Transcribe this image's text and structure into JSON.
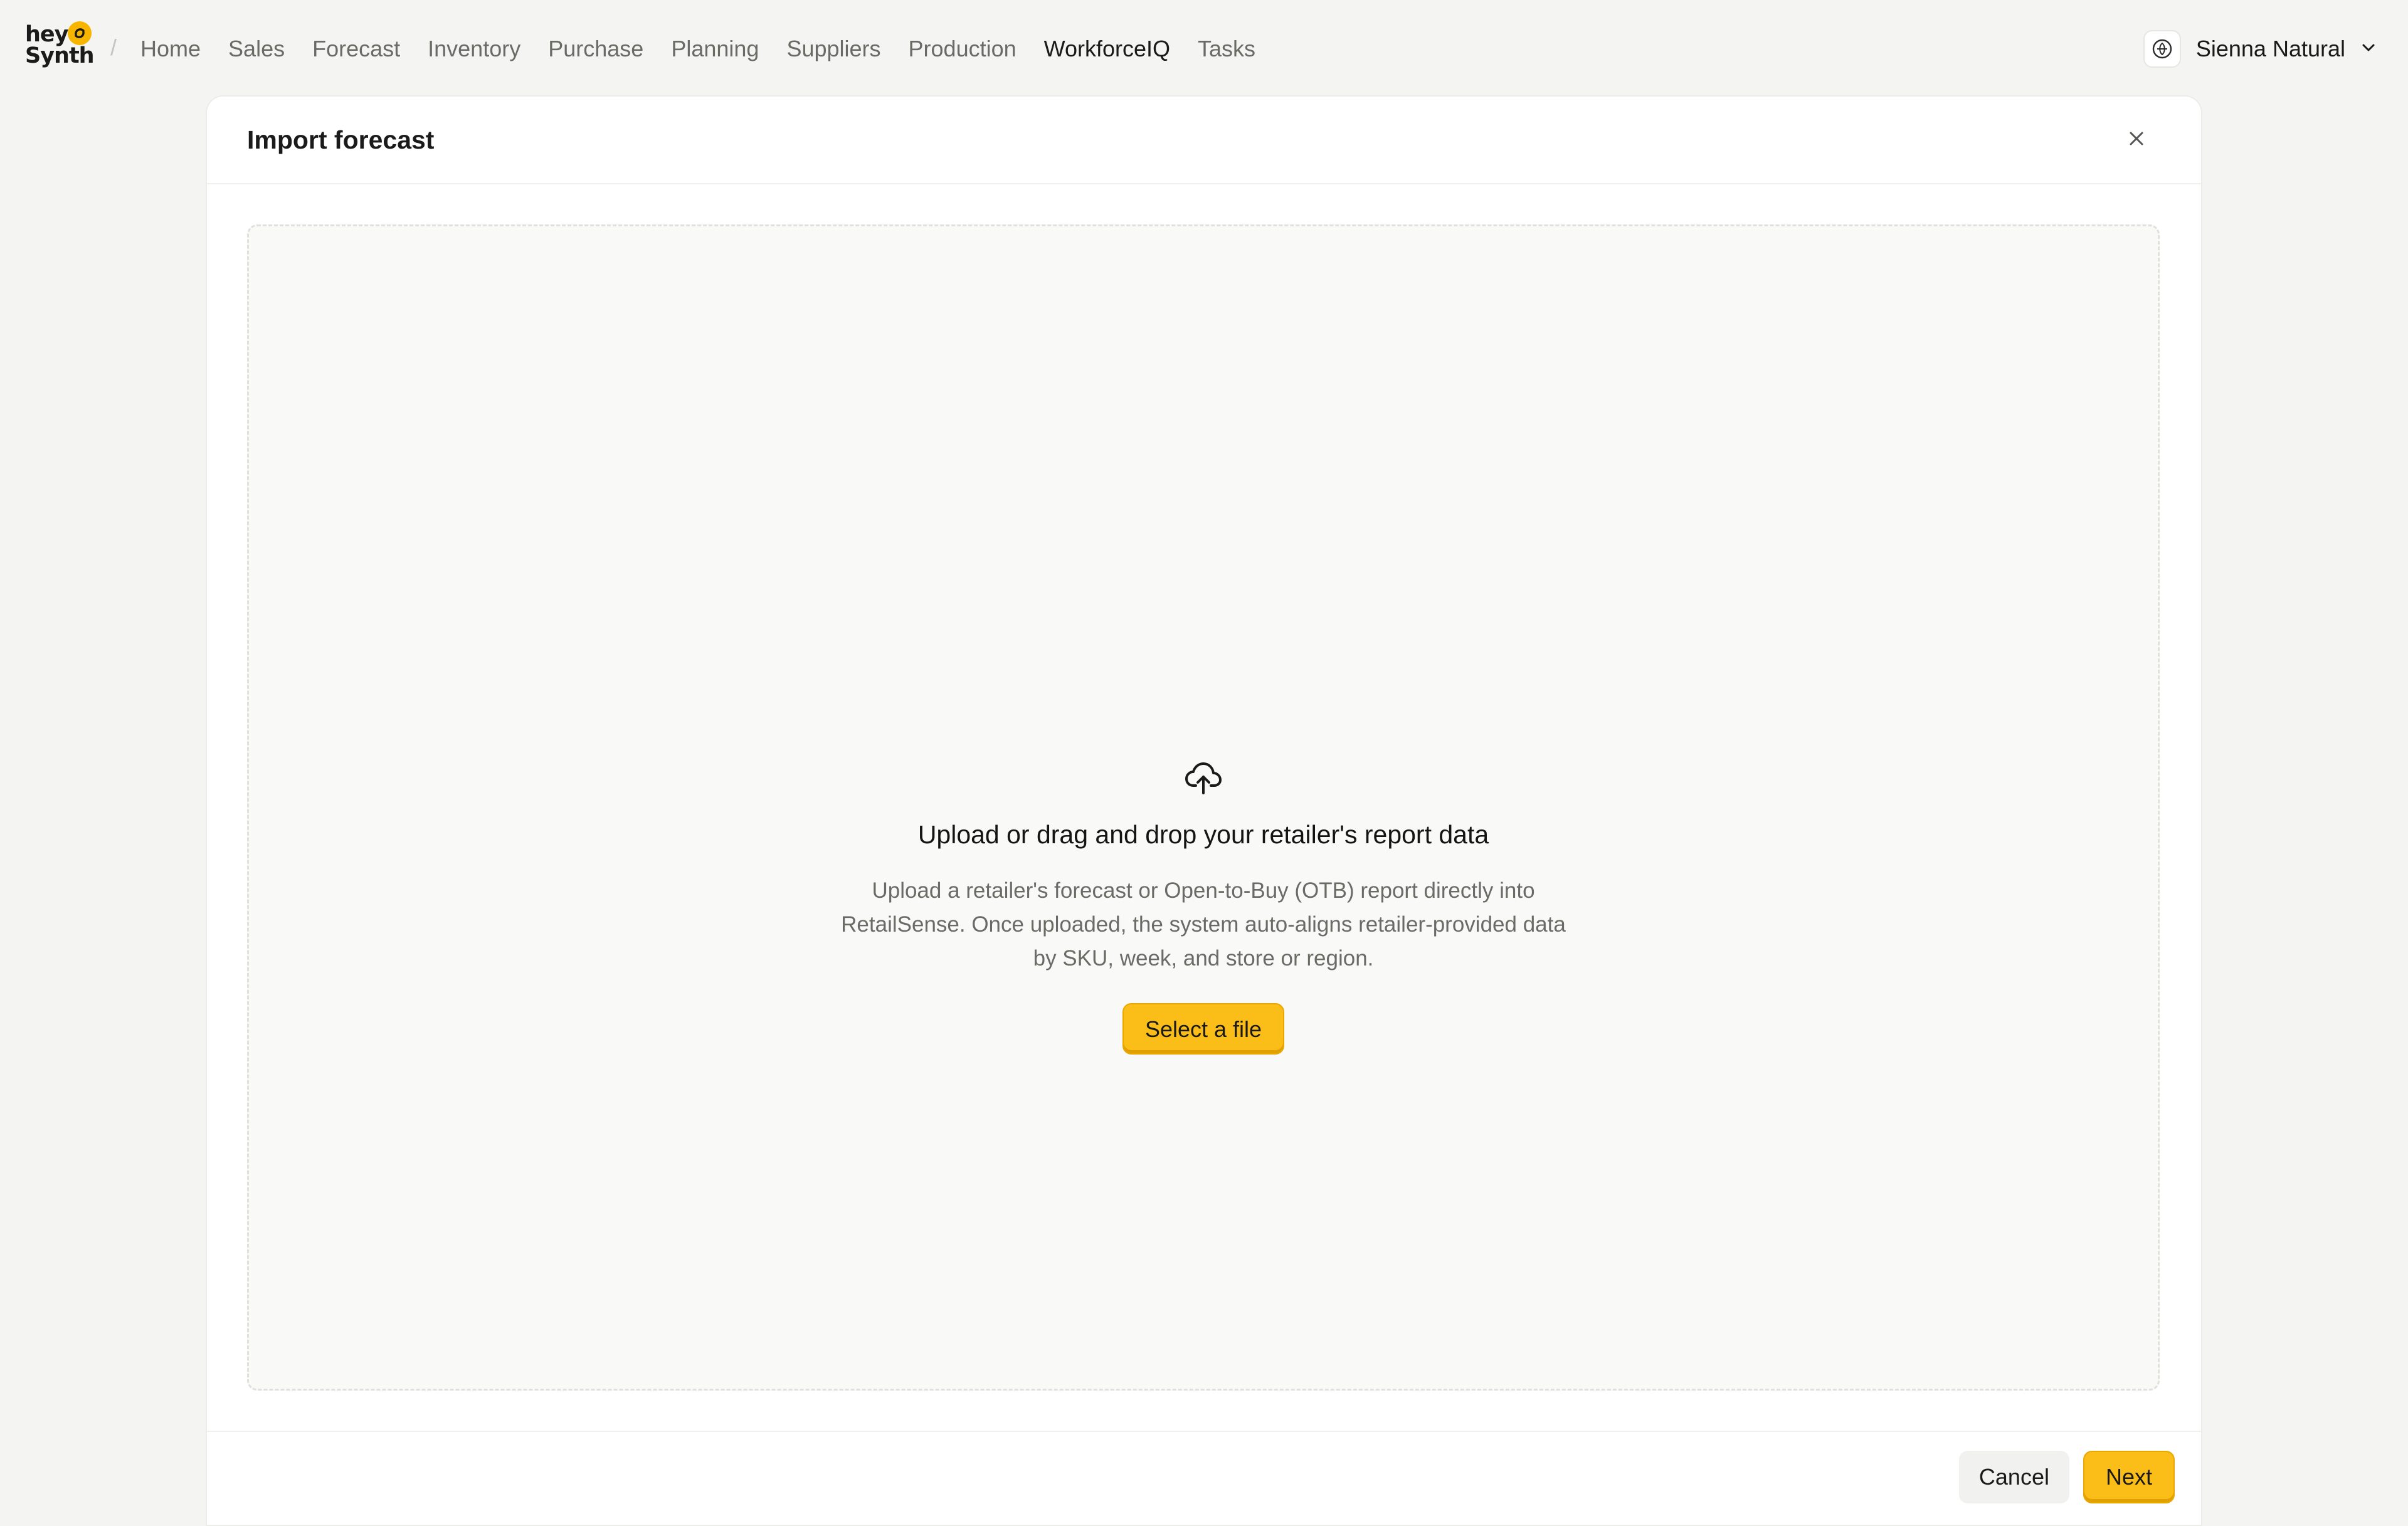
{
  "brand": {
    "logo_text_line1": "hey",
    "logo_text_line2": "Synth",
    "accent": "#fbbd17"
  },
  "nav": {
    "separator": "/",
    "items": [
      {
        "label": "Home",
        "active": false
      },
      {
        "label": "Sales",
        "active": false
      },
      {
        "label": "Forecast",
        "active": false
      },
      {
        "label": "Inventory",
        "active": false
      },
      {
        "label": "Purchase",
        "active": false
      },
      {
        "label": "Planning",
        "active": false
      },
      {
        "label": "Suppliers",
        "active": false
      },
      {
        "label": "Production",
        "active": false
      },
      {
        "label": "WorkforceIQ",
        "active": true
      },
      {
        "label": "Tasks",
        "active": false
      }
    ]
  },
  "account": {
    "name": "Sienna Natural",
    "avatar_icon": "leaf-badge-icon",
    "dropdown_icon": "chevron-down-icon"
  },
  "modal": {
    "title": "Import forecast",
    "close_icon": "close-icon",
    "dropzone": {
      "icon": "cloud-upload-icon",
      "title": "Upload or drag and drop your retailer's report data",
      "description": "Upload a retailer's forecast or Open-to-Buy (OTB) report directly into RetailSense. Once uploaded, the system auto-aligns retailer-provided data by SKU, week, and store or region.",
      "select_label": "Select a file"
    },
    "footer": {
      "cancel_label": "Cancel",
      "next_label": "Next"
    }
  }
}
